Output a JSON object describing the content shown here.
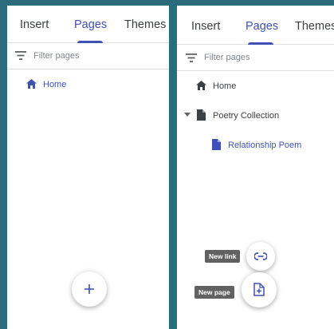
{
  "colors": {
    "accent": "#3f51b5",
    "background": "#2b6c7c",
    "text": "#3c4043"
  },
  "left_panel": {
    "tabs": [
      {
        "label": "Insert"
      },
      {
        "label": "Pages",
        "active": true
      },
      {
        "label": "Themes"
      }
    ],
    "filter": {
      "placeholder": "Filter pages",
      "icon": "filter-icon"
    },
    "pages": [
      {
        "label": "Home",
        "icon": "home-icon",
        "selected": true
      }
    ],
    "fab": {
      "label": "+",
      "icon": "plus-icon"
    }
  },
  "right_panel": {
    "tabs": [
      {
        "label": "Insert"
      },
      {
        "label": "Pages",
        "active": true
      },
      {
        "label": "Themes"
      }
    ],
    "filter": {
      "placeholder": "Filter pages",
      "icon": "filter-icon"
    },
    "pages": [
      {
        "label": "Home",
        "icon": "home-icon"
      },
      {
        "label": "Poetry Collection",
        "icon": "page-icon",
        "expanded": true
      },
      {
        "label": "Relationship Poem",
        "icon": "page-icon",
        "selected": true
      }
    ],
    "speed_dial": [
      {
        "tooltip": "New link",
        "icon": "link-icon"
      },
      {
        "tooltip": "New page",
        "icon": "new-page-icon"
      }
    ]
  }
}
